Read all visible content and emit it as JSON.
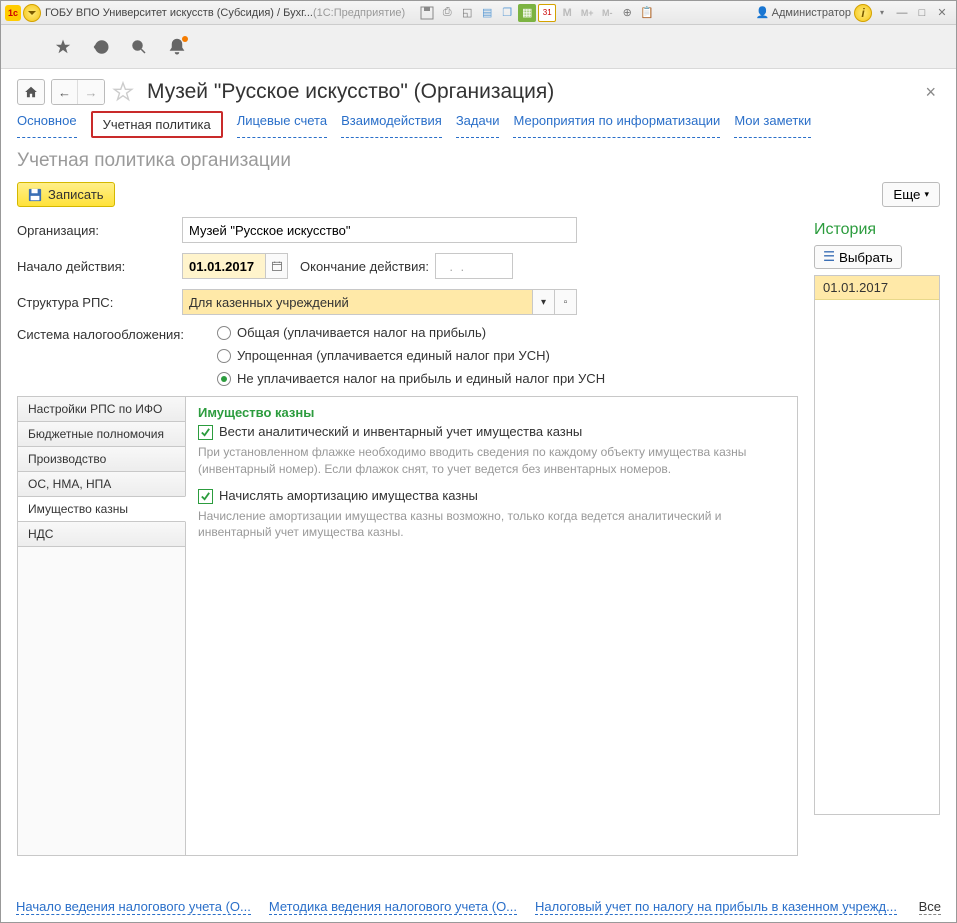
{
  "titlebar": {
    "title_a": "ГОБУ ВПО Университет искусств (Субсидия) / Бухг...",
    "title_b": " (1С:Предприятие)",
    "user_label": "Администратор"
  },
  "header": {
    "page_title": "Музей \"Русское искусство\" (Организация)"
  },
  "navtabs": {
    "t0": "Основное",
    "t1": "Учетная политика",
    "t2": "Лицевые счета",
    "t3": "Взаимодействия",
    "t4": "Задачи",
    "t5": "Мероприятия по информатизации",
    "t6": "Мои заметки"
  },
  "section_title": "Учетная политика организации",
  "buttons": {
    "save": "Записать",
    "more": "Еще"
  },
  "form": {
    "org_label": "Организация:",
    "org_value": "Музей \"Русское искусство\"",
    "start_label": "Начало действия:",
    "start_value": "01.01.2017",
    "end_label": "Окончание действия:",
    "end_value": "  .  .",
    "rps_label": "Структура РПС:",
    "rps_value": "Для казенных учреждений",
    "tax_label": "Система налогообложения:",
    "tax_opt1": "Общая (уплачивается налог на прибыль)",
    "tax_opt2": "Упрощенная (уплачивается единый налог при УСН)",
    "tax_opt3": "Не уплачивается налог на прибыль и единый налог при УСН"
  },
  "history": {
    "title": "История",
    "select": "Выбрать",
    "item1": "01.01.2017"
  },
  "side_tabs": {
    "t0": "Настройки РПС по ИФО",
    "t1": "Бюджетные полномочия",
    "t2": "Производство",
    "t3": "ОС, НМА, НПА",
    "t4": "Имущество казны",
    "t5": "НДС"
  },
  "pane": {
    "title": "Имущество казны",
    "chk1": "Вести аналитический и инвентарный учет имущества казны",
    "help1": "При установленном флажке необходимо вводить сведения по каждому объекту имущества казны (инвентарный номер). Если флажок снят, то учет ведется без инвентарных номеров.",
    "chk2": "Начислять амортизацию имущества казны",
    "help2": "Начисление амортизации имущества казны возможно, только когда ведется аналитический и инвентарный учет имущества казны."
  },
  "bottom": {
    "l1": "Начало ведения налогового учета (О...",
    "l2": "Методика ведения налогового учета (О...",
    "l3": "Налоговый учет по налогу на прибыль в казенном учрежд...",
    "all": "Все"
  }
}
